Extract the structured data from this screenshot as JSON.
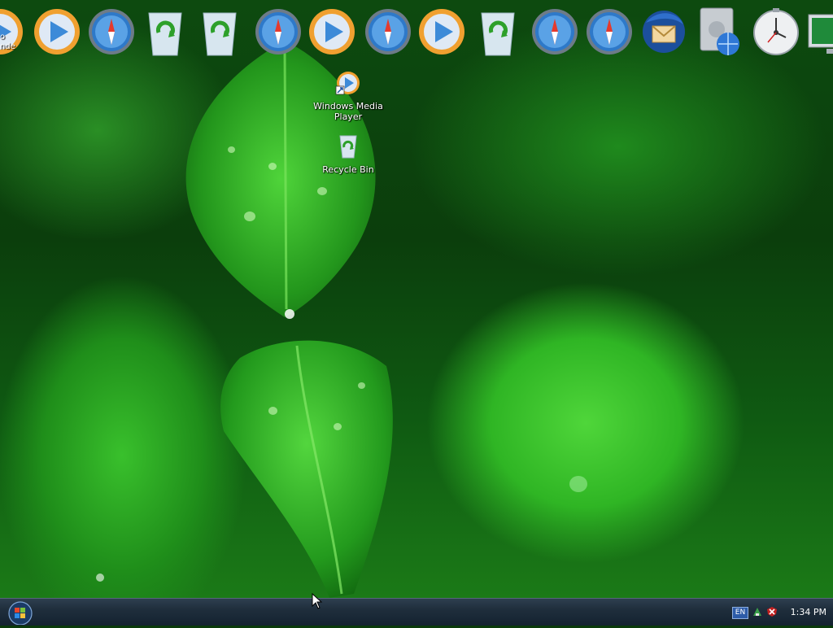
{
  "dock": {
    "items": [
      {
        "icon": "media-player-icon"
      },
      {
        "icon": "media-player-icon"
      },
      {
        "icon": "safari-compass-icon"
      },
      {
        "icon": "recycle-bin-icon"
      },
      {
        "icon": "recycle-bin-icon"
      },
      {
        "icon": "safari-compass-icon"
      },
      {
        "icon": "media-player-icon"
      },
      {
        "icon": "safari-compass-icon"
      },
      {
        "icon": "media-player-icon"
      },
      {
        "icon": "recycle-bin-icon"
      },
      {
        "icon": "safari-compass-icon"
      },
      {
        "icon": "safari-compass-icon"
      },
      {
        "icon": "thunderbird-mail-icon"
      },
      {
        "icon": "network-drive-icon"
      },
      {
        "icon": "clock-widget-icon"
      },
      {
        "icon": "monitor-icon"
      }
    ]
  },
  "desktop": {
    "partial_left_label": "o\nnde",
    "icons": [
      {
        "label": "Windows Media Player",
        "icon": "media-player-shortcut-icon"
      },
      {
        "label": "Recycle Bin",
        "icon": "recycle-bin-icon"
      }
    ]
  },
  "taskbar": {
    "language": "EN",
    "clock": "1:34 PM"
  },
  "colors": {
    "wallpaper_green": "#2fb524",
    "taskbar": "#1f2e3c"
  }
}
